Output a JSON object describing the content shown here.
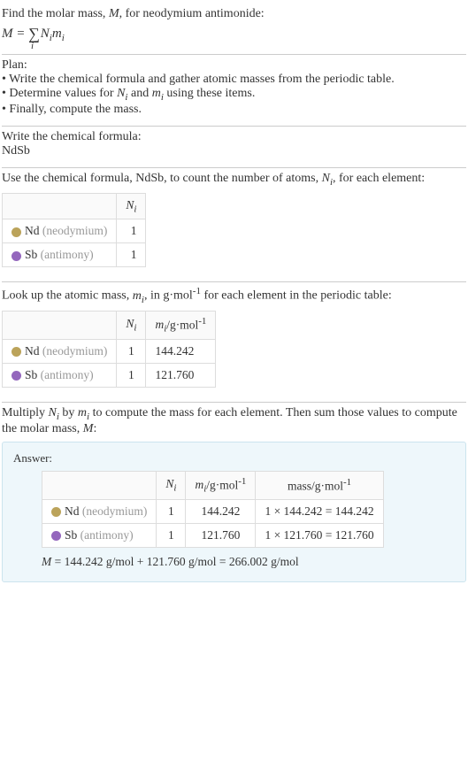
{
  "intro": {
    "line1_a": "Find the molar mass, ",
    "line1_b": ", for neodymium antimonide:"
  },
  "plan": {
    "title": "Plan:",
    "b1": "• Write the chemical formula and gather atomic masses from the periodic table.",
    "b2a": "• Determine values for ",
    "b2b": " and ",
    "b2c": " using these items.",
    "b3": "• Finally, compute the mass."
  },
  "chem": {
    "label": "Write the chemical formula:",
    "formula": "NdSb"
  },
  "count": {
    "text_a": "Use the chemical formula, NdSb, to count the number of atoms, ",
    "text_b": ", for each element:",
    "rows": [
      {
        "sym": "Nd",
        "name": "neodymium",
        "n": "1"
      },
      {
        "sym": "Sb",
        "name": "antimony",
        "n": "1"
      }
    ]
  },
  "lookup": {
    "text_a": "Look up the atomic mass, ",
    "text_b": ", in g·mol",
    "text_c": " for each element in the periodic table:",
    "rows": [
      {
        "sym": "Nd",
        "name": "neodymium",
        "n": "1",
        "m": "144.242"
      },
      {
        "sym": "Sb",
        "name": "antimony",
        "n": "1",
        "m": "121.760"
      }
    ]
  },
  "multiply": {
    "text_a": "Multiply ",
    "text_b": " by ",
    "text_c": " to compute the mass for each element. Then sum those values to compute the molar mass, ",
    "text_d": ":"
  },
  "answer": {
    "label": "Answer:",
    "hdr_mass": "mass/g·mol",
    "rows": [
      {
        "sym": "Nd",
        "name": "neodymium",
        "n": "1",
        "m": "144.242",
        "mass": "1 × 144.242 = 144.242"
      },
      {
        "sym": "Sb",
        "name": "antimony",
        "n": "1",
        "m": "121.760",
        "mass": "1 × 121.760 = 121.760"
      }
    ],
    "eq": " = 144.242 g/mol + 121.760 g/mol = 266.002 g/mol"
  },
  "sym": {
    "M": "M",
    "Ni": "N",
    "mi": "m",
    "i": "i",
    "neg1": "-1",
    "gmol": "/g·mol"
  }
}
